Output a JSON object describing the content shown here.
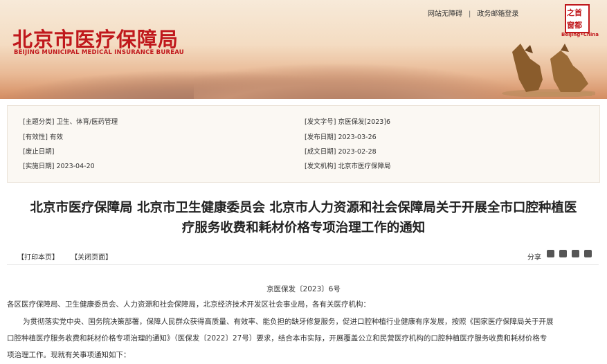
{
  "header": {
    "title_cn": "北京市医疗保障局",
    "title_en": "BEIJING MUNICIPAL MEDICAL INSURANCE BUREAU",
    "links": [
      "网站无障碍",
      "政务邮箱登录"
    ],
    "logo_caption": "Beijing•China"
  },
  "info": {
    "subject_label": "[主题分类]",
    "subject_value": "卫生、体育/医药管理",
    "validity_label": "[有效性]",
    "validity_value": "有效",
    "abolish_label": "[废止日期]",
    "abolish_value": "",
    "effective_label": "[实施日期]",
    "effective_value": "2023-04-20",
    "docno_label": "[发文字号]",
    "docno_value": "京医保发[2023]6",
    "publish_label": "[发布日期]",
    "publish_value": "2023-03-26",
    "written_label": "[成文日期]",
    "written_value": "2023-02-28",
    "issuer_label": "[发文机构]",
    "issuer_value": "北京市医疗保障局"
  },
  "article": {
    "title_line1": "北京市医疗保障局 北京市卫生健康委员会 北京市人力资源和社会保障局关于开展全市口腔种植医",
    "title_line2": "疗服务收费和耗材价格专项治理工作的通知",
    "print_label": "【打印本页】",
    "close_label": "【关闭页面】",
    "share_label": "分享",
    "doc_number": "京医保发〔2023〕6号",
    "para1": "各区医疗保障局、卫生健康委员会、人力资源和社会保障局，北京经济技术开发区社会事业局，各有关医疗机构：",
    "para2_line1": "为贯彻落实党中央、国务院决策部署，保障人民群众获得高质量、有效率、能负担的缺牙修复服务，促进口腔种植行业健康有序发展，按照《国家医疗保障局关于开展",
    "para2_line2": "口腔种植医疗服务收费和耗材价格专项治理的通知》（医保发〔2022〕27号）要求，结合本市实际，开展覆盖公立和民营医疗机构的口腔种植医疗服务收费和耗材价格专",
    "para2_line3": "项治理工作。现就有关事项通知如下："
  },
  "icons": [
    "weixin-icon",
    "weibo-icon",
    "qrcode-icon",
    "font-size-icon"
  ],
  "colors": {
    "brand_red": "#c0181c",
    "info_bg": "#fbf8f3"
  }
}
